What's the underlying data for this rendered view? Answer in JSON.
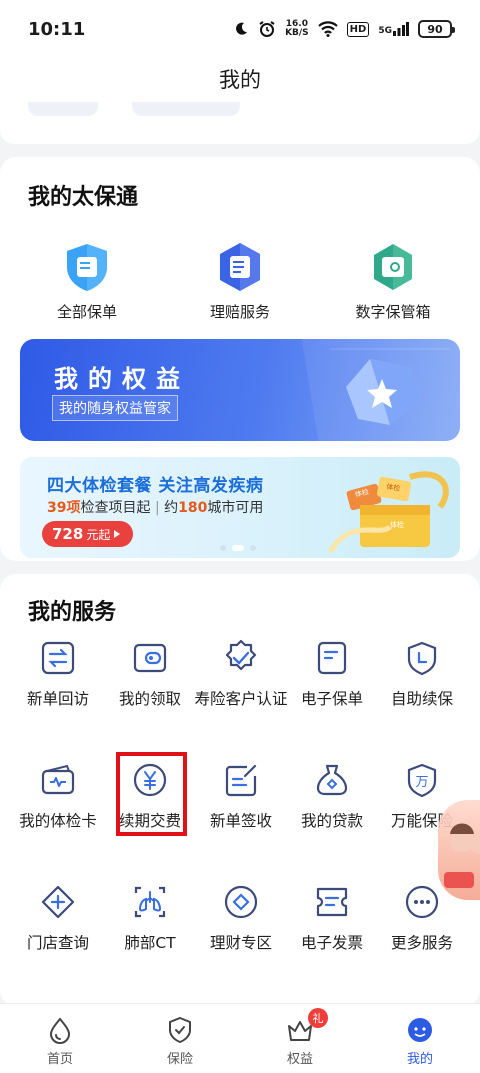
{
  "status_bar": {
    "time": "10:11",
    "speed_value": "16.0",
    "speed_unit": "KB/S",
    "hd": "HD",
    "network": "5G",
    "battery": "90"
  },
  "navbar": {
    "title": "我的"
  },
  "taibaotong": {
    "title": "我的太保通",
    "items": [
      {
        "label": "全部保单",
        "icon": "policy-shield-icon",
        "color": "#3aa3f5"
      },
      {
        "label": "理赔服务",
        "icon": "claims-hexagon-icon",
        "color": "#3b63e6"
      },
      {
        "label": "数字保管箱",
        "icon": "safe-box-icon",
        "color": "#2fa98a"
      }
    ]
  },
  "rights_banner": {
    "title": "我的权益",
    "subtitle": "我的随身权益管家"
  },
  "promo": {
    "title": "四大体检套餐  关注高发疾病",
    "count": "39项",
    "mid": "检查项目起",
    "sep": "|",
    "pre": "约",
    "cities": "180",
    "post": "城市可用",
    "price": "728",
    "price_suffix": "元起",
    "card_labels": [
      "体检",
      "体检",
      "体检"
    ]
  },
  "services": {
    "title": "我的服务",
    "items": [
      {
        "label": "新单回访",
        "icon": "return-visit-icon"
      },
      {
        "label": "我的领取",
        "icon": "wallet-icon"
      },
      {
        "label": "寿险客户认证",
        "icon": "verified-badge-icon"
      },
      {
        "label": "电子保单",
        "icon": "e-policy-icon"
      },
      {
        "label": "自助续保",
        "icon": "renew-shield-icon"
      },
      {
        "label": "我的体检卡",
        "icon": "health-card-icon"
      },
      {
        "label": "续期交费",
        "icon": "yuan-coin-icon"
      },
      {
        "label": "新单签收",
        "icon": "sign-edit-icon"
      },
      {
        "label": "我的贷款",
        "icon": "money-bag-icon"
      },
      {
        "label": "万能保险",
        "icon": "universal-shield-icon"
      },
      {
        "label": "门店查询",
        "icon": "store-locate-icon"
      },
      {
        "label": "肺部CT",
        "icon": "lungs-ct-icon"
      },
      {
        "label": "理财专区",
        "icon": "finance-diamond-icon"
      },
      {
        "label": "电子发票",
        "icon": "invoice-icon"
      },
      {
        "label": "更多服务",
        "icon": "more-dots-icon"
      }
    ]
  },
  "tabs": [
    {
      "label": "首页",
      "icon": "home-drop-icon"
    },
    {
      "label": "保险",
      "icon": "insurance-shield-icon"
    },
    {
      "label": "权益",
      "icon": "crown-gift-icon",
      "badge": "礼"
    },
    {
      "label": "我的",
      "icon": "profile-face-icon",
      "active": true
    }
  ],
  "colors": {
    "accent": "#2d5be3",
    "icon_stroke": "#3d4b7a",
    "price_red": "#e8413e"
  }
}
